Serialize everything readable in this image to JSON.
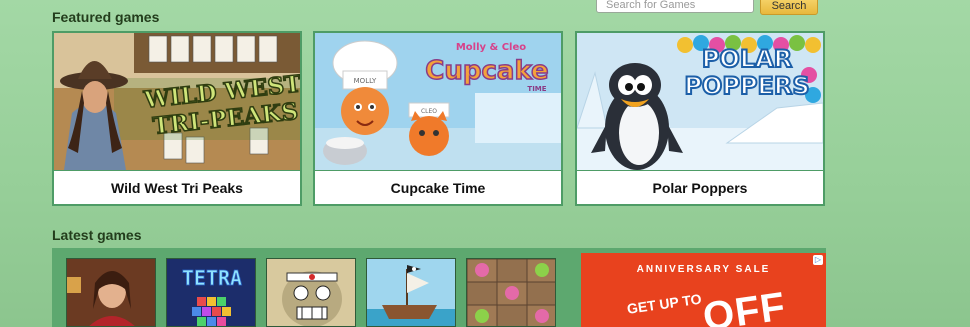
{
  "search": {
    "placeholder": "Search for Games",
    "button_label": "Search"
  },
  "featured": {
    "title": "Featured games",
    "cards": [
      {
        "label": "Wild West Tri Peaks",
        "art_title_1": "WILD WEST",
        "art_title_2": "TRI-PEAKS"
      },
      {
        "label": "Cupcake Time",
        "art_brand": "Molly & Cleo",
        "art_title": "Cupcake",
        "art_sub": "TIME",
        "hat_text_1": "MOLLY",
        "hat_text_2": "CLEO"
      },
      {
        "label": "Polar Poppers",
        "art_title_1": "POLAR",
        "art_title_2": "POPPERS"
      }
    ]
  },
  "latest": {
    "title": "Latest games",
    "thumbs": [
      {
        "icon": "woman-portrait-thumb"
      },
      {
        "icon": "tetra-blocks-thumb",
        "art_title": "TETRA"
      },
      {
        "icon": "robot-face-thumb"
      },
      {
        "icon": "pirate-ship-thumb"
      },
      {
        "icon": "skulls-match-thumb"
      }
    ]
  },
  "ad": {
    "line1": "ANNIVERSARY SALE",
    "line2": "GET UP TO",
    "line3": "OFF",
    "choice_icon": "▷"
  },
  "colors": {
    "background": "#97cf99",
    "card_border": "#4e9c66",
    "search_button": "#f0c553",
    "ad": "#e8421e"
  }
}
